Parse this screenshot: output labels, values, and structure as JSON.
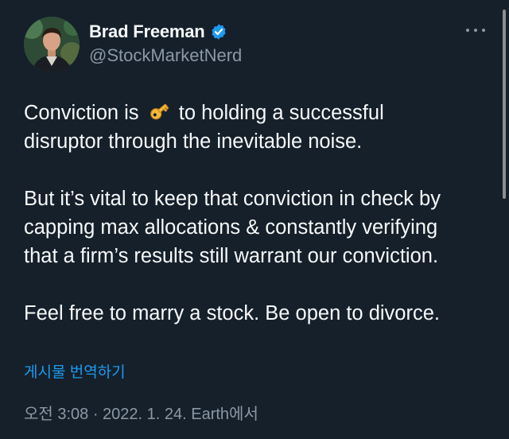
{
  "author": {
    "display_name": "Brad Freeman",
    "handle": "@StockMarketNerd",
    "verified": true
  },
  "tweet": {
    "paragraphs": [
      {
        "lines": [
          {
            "before": "Conviction is ",
            "emoji": "key-emoji",
            "after": " to holding a successful"
          },
          {
            "text": "disruptor through the inevitable noise."
          }
        ]
      },
      {
        "lines": [
          {
            "text": "But it’s vital to keep that conviction in check by"
          },
          {
            "text": "capping max allocations & constantly verifying"
          },
          {
            "text": "that a firm’s results still warrant our conviction."
          }
        ]
      },
      {
        "lines": [
          {
            "text": "Feel free to marry a stock. Be open to divorce."
          }
        ]
      }
    ],
    "translate_label": "게시물 번역하기",
    "timestamp": "오전 3:08 · 2022. 1. 24. Earth에서"
  },
  "icons": {
    "more": "more-horizontal-icon",
    "verified": "verified-badge-icon",
    "key": "key-emoji"
  },
  "colors": {
    "background": "#15202b",
    "text_primary": "#f7f9f9",
    "text_secondary": "#8b98a5",
    "link": "#1d9bf0",
    "verified_badge": "#1d9bf0"
  }
}
